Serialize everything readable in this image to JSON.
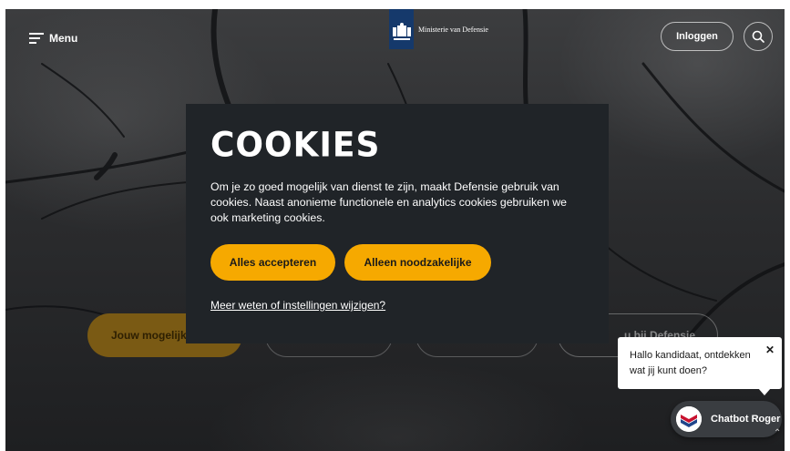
{
  "header": {
    "menu_label": "Menu",
    "logo_text": "Ministerie van Defensie",
    "login_label": "Inloggen"
  },
  "hero": {
    "pills": [
      "Jouw mogelijkh",
      "",
      "",
      "u bij Defensie"
    ]
  },
  "cookie_banner": {
    "title": "COOKIES",
    "text": "Om je zo goed mogelijk van dienst te zijn, maakt Defensie gebruik van cookies. Naast anonieme functionele en analytics cookies gebruiken we ook marketing cookies.",
    "accept_all_label": "Alles accepteren",
    "necessary_only_label": "Alleen noodzakelijke",
    "settings_link": "Meer weten of instellingen wijzigen?"
  },
  "chat": {
    "bubble_text": "Hallo kandidaat, ontdekken wat jij kunt doen?",
    "close_glyph": "✕",
    "button_label": "Chatbot Roger"
  },
  "colors": {
    "accent_yellow": "#f6a900",
    "modal_bg": "#202428",
    "logo_blue": "#15396b"
  }
}
